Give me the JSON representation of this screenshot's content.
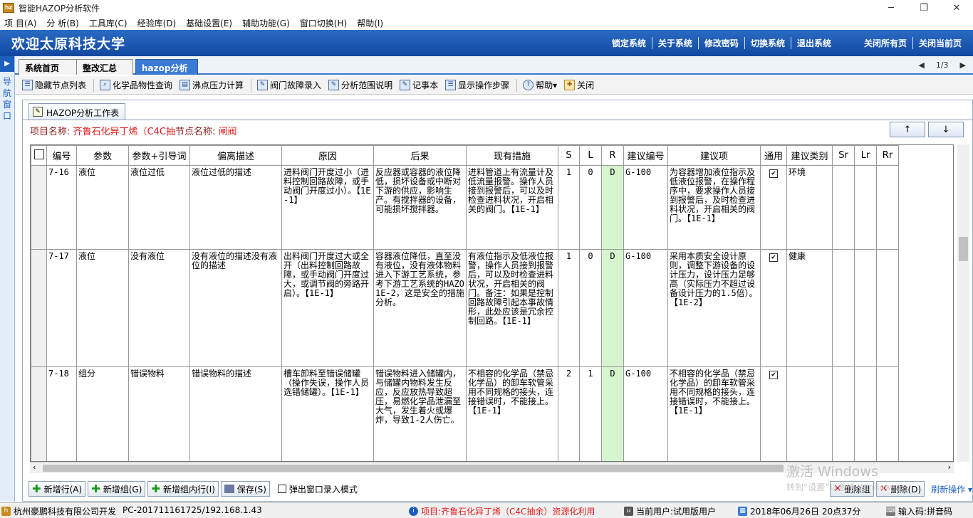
{
  "window": {
    "title": "智能HAZOP分析软件",
    "app_icon": "hazop-app-icon",
    "minimize": "─",
    "maximize": "❐",
    "close": "✕"
  },
  "menu": [
    {
      "label": "项 目(A)"
    },
    {
      "label": "分 析(B)"
    },
    {
      "label": "工具库(C)"
    },
    {
      "label": "经验库(D)"
    },
    {
      "label": "基础设置(E)"
    },
    {
      "label": "辅助功能(G)"
    },
    {
      "label": "窗口切换(H)"
    },
    {
      "label": "帮助(I)"
    }
  ],
  "banner": {
    "welcome": "欢迎太原科技大学",
    "links": [
      "锁定系统",
      "关于系统",
      "修改密码",
      "切换系统",
      "退出系统"
    ],
    "right_links": [
      "关闭所有页",
      "关闭当前页"
    ]
  },
  "left_nav": {
    "label": "导航窗口",
    "arrow": "▶"
  },
  "tabs": [
    {
      "label": "系统首页"
    },
    {
      "label": "整改汇总"
    },
    {
      "label": "hazop分析",
      "close": "×"
    }
  ],
  "pager": {
    "prev": "◀",
    "page": "1/3",
    "next": "▶"
  },
  "toolbar": [
    {
      "label": "隐藏节点列表",
      "icon": "list-icon"
    },
    {
      "label": "化学品物性查询",
      "icon": "search-icon"
    },
    {
      "label": "沸点压力计算",
      "icon": "calc-icon"
    },
    {
      "label": "阀门故障录入",
      "icon": "valve-icon"
    },
    {
      "label": "分析范围说明",
      "icon": "scope-icon"
    },
    {
      "label": "记事本",
      "icon": "notepad-icon"
    },
    {
      "label": "显示操作步骤",
      "icon": "steps-icon"
    },
    {
      "label": "帮助▾",
      "icon": "help-icon"
    },
    {
      "label": "关闭",
      "icon": "close-icon"
    }
  ],
  "worktab": {
    "label": "HAZOP分析工作表"
  },
  "project": {
    "name_label": "项目名称: ",
    "name_value": "齐鲁石化异丁烯（C4C抽",
    "node_label": "节点名称: ",
    "node_value": "闸阀"
  },
  "updown": {
    "up": "↑",
    "down": "↓"
  },
  "table": {
    "headers": [
      "编号",
      "参数",
      "参数+引导词",
      "偏离描述",
      "原因",
      "后果",
      "现有措施",
      "S",
      "L",
      "R",
      "建议编号",
      "建议项",
      "通用",
      "建议类别",
      "Sr",
      "Lr",
      "Rr"
    ],
    "rows": [
      {
        "id": "7-16",
        "param": "液位",
        "guide": "液位过低",
        "dev": "液位过低的描述",
        "cause": "进料阀门开度过小（进料控制回路故障，或手动阀门开度过小）。【1E-1】",
        "conseq": "反应器或容器的液位降低，损坏设备或中断对下游的供应，影响生产。有搅拌器的设备，可能损坏搅拌器。",
        "measure": "进料管道上有流量计及低流量报警。操作人员接到报警后，可以及时检查进料状况，开启相关的阀门。【1E-1】",
        "s": "1",
        "l": "0",
        "r": "D",
        "sug_no": "G-100",
        "sug": "为容器增加液位指示及低液位报警，在操作程序中，要求操作人员接到报警后，及时检查进料状况，开启相关的阀门。【1E-1】",
        "general": "✔",
        "cat": "环境",
        "sr": "",
        "lr": "",
        "rr": ""
      },
      {
        "id": "7-17",
        "param": "液位",
        "guide": "没有液位",
        "dev": "没有液位的描述没有液位的描述",
        "cause": "出料阀门开度过大或全开（出料控制回路故障，或手动阀门开度过大，或调节阀的旁路开启）。【1E-1】",
        "conseq": "容器液位降低，直至没有液位，没有液体物料进入下游工艺系统，参考下游工艺系统的HAZO1E-2，这是安全的措施分析。",
        "measure": "有液位指示及低液位报警，操作人员接到报警后，可以及时检查进料状况，开启相关的阀门。备注：如果是控制回路故障引起本事故情形，此处应该是冗余控制回路。【1E-1】",
        "s": "1",
        "l": "0",
        "r": "D",
        "sug_no": "G-100",
        "sug": "采用本质安全设计原则，调整下游设备的设计压力，设计压力足够高（实际压力不超过设备设计压力的1.5倍）。【1E-2】",
        "general": "✔",
        "cat": "健康",
        "sr": "",
        "lr": "",
        "rr": ""
      },
      {
        "id": "7-18",
        "param": "组分",
        "guide": "错误物料",
        "dev": "错误物料的描述",
        "cause": "槽车卸料至错误储罐（操作失误，操作人员选错储罐）。【1E-1】",
        "conseq": "错误物料进入储罐内，与储罐内物料发生反应，反应放热导致超压，易燃化学品泄漏至大气，发生着火或爆炸，导致1-2人伤亡。",
        "measure": "不相容的化学品（禁忌化学品）的卸车软管采用不同规格的接头，连接错误时，不能接上。【1E-1】",
        "s": "2",
        "l": "1",
        "r": "D",
        "sug_no": "G-100",
        "sug": "不相容的化学品（禁忌化学品）的卸车软管采用不同规格的接头，连接错误时，不能接上。【1E-1】",
        "general": "✔",
        "cat": "",
        "sr": "",
        "lr": "",
        "rr": ""
      }
    ]
  },
  "bottom": {
    "add_row": "新增行(A)",
    "add_group": "新增组(G)",
    "add_in_group": "新增组内行(I)",
    "save": "保存(S)",
    "popup_mode": "弹出窗口录入模式",
    "del_group": "删除组",
    "del": "删除(D)",
    "refresh": "刷新操作 ▾"
  },
  "watermark": {
    "line1": "激活 Windows",
    "line2": "转到“设置”以激活 Windows。"
  },
  "status": {
    "company": "杭州豪鹏科技有限公司开发",
    "pc": "PC-201711161725/192.168.1.43",
    "project": "项目:齐鲁石化异丁烯（C4C抽余）资源化利用",
    "user": "当前用户:试用版用户",
    "date": "2018年06月26日 20点37分",
    "ime": "输入码:拼音码"
  }
}
